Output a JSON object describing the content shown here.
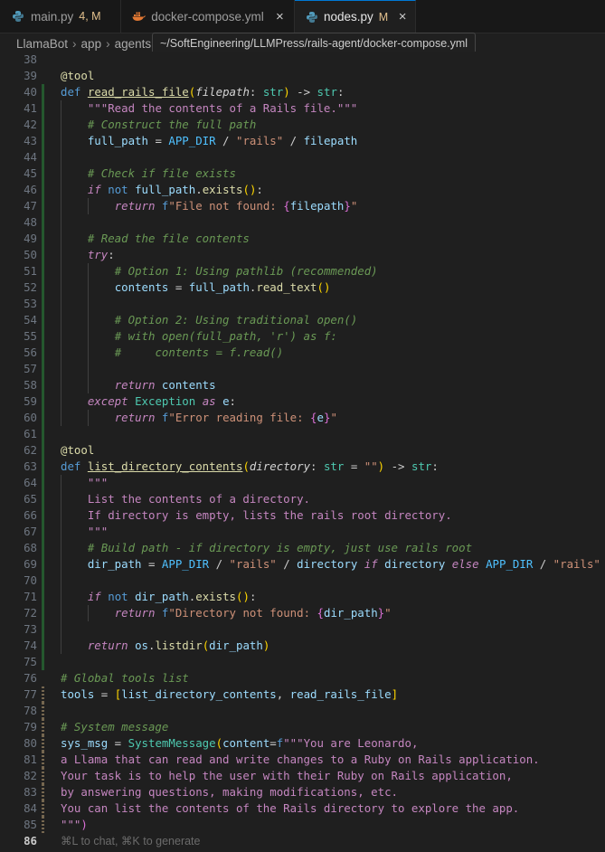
{
  "tabs": [
    {
      "name": "main.py",
      "badge": "4, M",
      "icon": "python-icon"
    },
    {
      "name": "docker-compose.yml",
      "icon": "docker-icon"
    },
    {
      "name": "nodes.py",
      "badge": "M",
      "icon": "python-icon",
      "active": true
    }
  ],
  "breadcrumb": [
    "LlamaBot",
    "app",
    "agents"
  ],
  "tooltip": "~/SoftEngineering/LLMPress/rails-agent/docker-compose.yml",
  "editor": {
    "current_line": 86,
    "hint_text": "⌘L to chat, ⌘K to generate",
    "lines": [
      {
        "n": 38,
        "text": ""
      },
      {
        "n": 39,
        "text": "@tool"
      },
      {
        "n": 40,
        "text": "def read_rails_file(filepath: str) -> str:"
      },
      {
        "n": 41,
        "text": "    \"\"\"Read the contents of a Rails file.\"\"\""
      },
      {
        "n": 42,
        "text": "    # Construct the full path"
      },
      {
        "n": 43,
        "text": "    full_path = APP_DIR / \"rails\" / filepath"
      },
      {
        "n": 44,
        "text": ""
      },
      {
        "n": 45,
        "text": "    # Check if file exists"
      },
      {
        "n": 46,
        "text": "    if not full_path.exists():"
      },
      {
        "n": 47,
        "text": "        return f\"File not found: {filepath}\""
      },
      {
        "n": 48,
        "text": ""
      },
      {
        "n": 49,
        "text": "    # Read the file contents"
      },
      {
        "n": 50,
        "text": "    try:"
      },
      {
        "n": 51,
        "text": "        # Option 1: Using pathlib (recommended)"
      },
      {
        "n": 52,
        "text": "        contents = full_path.read_text()"
      },
      {
        "n": 53,
        "text": ""
      },
      {
        "n": 54,
        "text": "        # Option 2: Using traditional open()"
      },
      {
        "n": 55,
        "text": "        # with open(full_path, 'r') as f:"
      },
      {
        "n": 56,
        "text": "        #     contents = f.read()"
      },
      {
        "n": 57,
        "text": ""
      },
      {
        "n": 58,
        "text": "        return contents"
      },
      {
        "n": 59,
        "text": "    except Exception as e:"
      },
      {
        "n": 60,
        "text": "        return f\"Error reading file: {e}\""
      },
      {
        "n": 61,
        "text": ""
      },
      {
        "n": 62,
        "text": "@tool"
      },
      {
        "n": 63,
        "text": "def list_directory_contents(directory: str = \"\") -> str:"
      },
      {
        "n": 64,
        "text": "    \"\"\""
      },
      {
        "n": 65,
        "text": "    List the contents of a directory."
      },
      {
        "n": 66,
        "text": "    If directory is empty, lists the rails root directory."
      },
      {
        "n": 67,
        "text": "    \"\"\""
      },
      {
        "n": 68,
        "text": "    # Build path - if directory is empty, just use rails root"
      },
      {
        "n": 69,
        "text": "    dir_path = APP_DIR / \"rails\" / directory if directory else APP_DIR / \"rails\""
      },
      {
        "n": 70,
        "text": ""
      },
      {
        "n": 71,
        "text": "    if not dir_path.exists():"
      },
      {
        "n": 72,
        "text": "        return f\"Directory not found: {dir_path}\""
      },
      {
        "n": 73,
        "text": ""
      },
      {
        "n": 74,
        "text": "    return os.listdir(dir_path)"
      },
      {
        "n": 75,
        "text": ""
      },
      {
        "n": 76,
        "text": "# Global tools list"
      },
      {
        "n": 77,
        "text": "tools = [list_directory_contents, read_rails_file]"
      },
      {
        "n": 78,
        "text": ""
      },
      {
        "n": 79,
        "text": "# System message"
      },
      {
        "n": 80,
        "text": "sys_msg = SystemMessage(content=f\"\"\"You are Leonardo,"
      },
      {
        "n": 81,
        "text": "a Llama that can read and write changes to a Ruby on Rails application."
      },
      {
        "n": 82,
        "text": "Your task is to help the user with their Ruby on Rails application,"
      },
      {
        "n": 83,
        "text": "by answering questions, making modifications, etc."
      },
      {
        "n": 84,
        "text": "You can list the contents of the Rails directory to explore the app."
      },
      {
        "n": 85,
        "text": "\"\"\")"
      },
      {
        "n": 86,
        "text": ""
      }
    ]
  }
}
